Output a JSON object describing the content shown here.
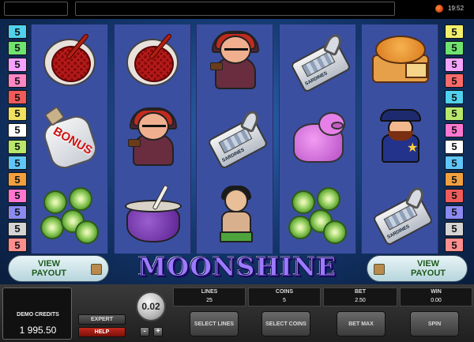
{
  "topbar": {
    "time": "19:52"
  },
  "line_indicators": {
    "left": [
      {
        "label": "5",
        "color": "#4fd2ee"
      },
      {
        "label": "5",
        "color": "#6fe36f"
      },
      {
        "label": "5",
        "color": "#f5a3ff"
      },
      {
        "label": "5",
        "color": "#ff86c4"
      },
      {
        "label": "5",
        "color": "#ef5b5b"
      },
      {
        "label": "5",
        "color": "#f0e060"
      },
      {
        "label": "5",
        "color": "#ffffff"
      },
      {
        "label": "5",
        "color": "#b7e86a"
      },
      {
        "label": "5",
        "color": "#5fc6f8"
      },
      {
        "label": "5",
        "color": "#f1a040"
      },
      {
        "label": "5",
        "color": "#ff77d0"
      },
      {
        "label": "5",
        "color": "#8a8af0"
      },
      {
        "label": "5",
        "color": "#d4d4d4"
      },
      {
        "label": "5",
        "color": "#ff8e8e"
      }
    ],
    "right": [
      {
        "label": "5",
        "color": "#f2ef6a"
      },
      {
        "label": "5",
        "color": "#6fe36f"
      },
      {
        "label": "5",
        "color": "#f5a3ff"
      },
      {
        "label": "5",
        "color": "#ff6a6a"
      },
      {
        "label": "5",
        "color": "#4fd2ee"
      },
      {
        "label": "5",
        "color": "#b7e86a"
      },
      {
        "label": "5",
        "color": "#ff77d0"
      },
      {
        "label": "5",
        "color": "#ffffff"
      },
      {
        "label": "5",
        "color": "#5fc6f8"
      },
      {
        "label": "5",
        "color": "#f1a040"
      },
      {
        "label": "5",
        "color": "#ef5b5b"
      },
      {
        "label": "5",
        "color": "#8a8af0"
      },
      {
        "label": "5",
        "color": "#d4d4d4"
      },
      {
        "label": "5",
        "color": "#ff8e8e"
      }
    ]
  },
  "reels": [
    {
      "symbols": [
        "red-bowl",
        "bonus-jug",
        "green-limes"
      ]
    },
    {
      "symbols": [
        "red-bowl",
        "moonshiner",
        "purple-pot"
      ]
    },
    {
      "symbols": [
        "moonshiner",
        "sardine-can",
        "hillbilly-girl"
      ]
    },
    {
      "symbols": [
        "sardine-can",
        "purple-pig",
        "green-limes"
      ]
    },
    {
      "symbols": [
        "pumpkin-pie",
        "sheriff",
        "sardine-can"
      ]
    }
  ],
  "symbol_text": {
    "bonus": "BONUS",
    "sardines": "SARDINES"
  },
  "banner": {
    "title": "MOONSHINE",
    "payout_left": "VIEW PAYOUT",
    "payout_right": "VIEW PAYOUT"
  },
  "panel": {
    "credits_label": "DEMO CREDITS",
    "credits_value": "1 995.50",
    "expert_label": "EXPERT",
    "help_label": "HELP",
    "coin_value": "0.02",
    "minus_label": "-",
    "plus_label": "+",
    "lines_label": "LINES",
    "lines_value": "25",
    "coins_label": "COINS",
    "coins_value": "5",
    "bet_label": "BET",
    "bet_value": "2.50",
    "win_label": "WIN",
    "win_value": "0.00",
    "select_lines_label": "SELECT LINES",
    "select_coins_label": "SELECT COINS",
    "bet_max_label": "BET MAX",
    "spin_label": "SPIN"
  }
}
